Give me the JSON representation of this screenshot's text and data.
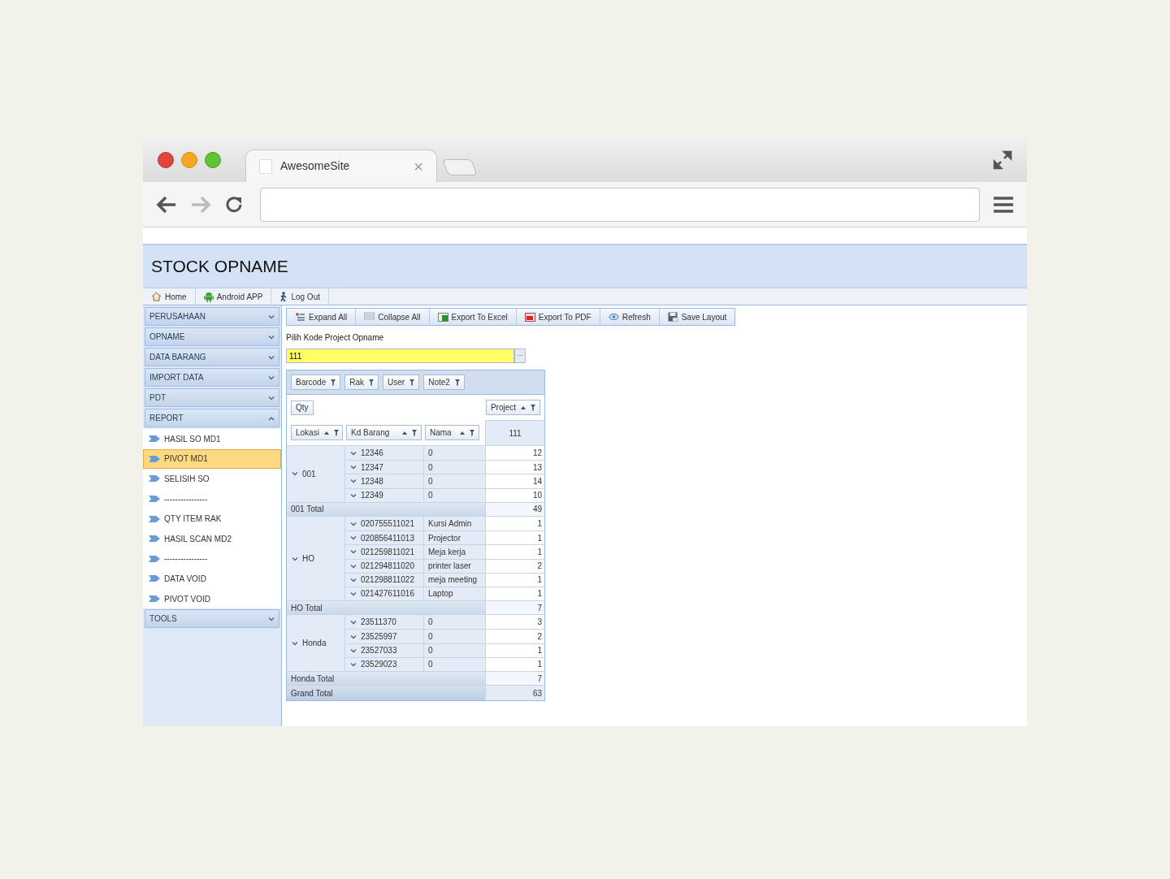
{
  "browser": {
    "tab_title": "AwesomeSite",
    "tab_close": "×"
  },
  "page": {
    "title": "STOCK OPNAME"
  },
  "nav": [
    {
      "label": "Home",
      "kind": "home"
    },
    {
      "label": "Android APP",
      "kind": "android"
    },
    {
      "label": "Log Out",
      "kind": "person"
    }
  ],
  "sidebar": [
    {
      "label": "PERUSAHAAN",
      "expanded": false
    },
    {
      "label": "OPNAME",
      "expanded": false
    },
    {
      "label": "DATA BARANG",
      "expanded": false
    },
    {
      "label": "IMPORT DATA",
      "expanded": false
    },
    {
      "label": "PDT",
      "expanded": false
    },
    {
      "label": "REPORT",
      "expanded": true,
      "items": [
        {
          "label": "HASIL SO MD1",
          "selected": false
        },
        {
          "label": "PIVOT MD1",
          "selected": true
        },
        {
          "label": "SELISIH SO",
          "selected": false
        },
        {
          "label": "----------------",
          "selected": false
        },
        {
          "label": "QTY ITEM RAK",
          "selected": false
        },
        {
          "label": "HASIL SCAN MD2",
          "selected": false
        },
        {
          "label": "----------------",
          "selected": false
        },
        {
          "label": "DATA VOID",
          "selected": false
        },
        {
          "label": "PIVOT VOID",
          "selected": false
        }
      ]
    },
    {
      "label": "TOOLS",
      "expanded": false
    }
  ],
  "toolbar": [
    {
      "label": "Expand All",
      "kind": "expand"
    },
    {
      "label": "Collapse All",
      "kind": "collapse"
    },
    {
      "label": "Export To Excel",
      "kind": "excel"
    },
    {
      "label": "Export To PDF",
      "kind": "pdf"
    },
    {
      "label": "Refresh",
      "kind": "refresh"
    },
    {
      "label": "Save Layout",
      "kind": "save"
    }
  ],
  "project_field": {
    "label": "Pilih Kode Project Opname",
    "value": "111",
    "button": "···"
  },
  "pivot": {
    "filter_fields": [
      {
        "label": "Barcode",
        "sorted": false
      },
      {
        "label": "Rak",
        "sorted": false
      },
      {
        "label": "User",
        "sorted": false
      },
      {
        "label": "Note2",
        "sorted": false
      }
    ],
    "data_field": "Qty",
    "column_field": {
      "label": "Project",
      "sorted": true
    },
    "row_fields": [
      {
        "label": "Lokasi",
        "sorted": true
      },
      {
        "label": "Kd Barang",
        "sorted": true
      },
      {
        "label": "Nama",
        "sorted": true
      }
    ],
    "column_value": "111",
    "groups": [
      {
        "label": "001",
        "expanded": true,
        "total_label": "001 Total",
        "total": "49",
        "rows": [
          {
            "code": "12346",
            "name": "0",
            "value": "12",
            "expanded": true
          },
          {
            "code": "12347",
            "name": "0",
            "value": "13",
            "expanded": true
          },
          {
            "code": "12348",
            "name": "0",
            "value": "14",
            "expanded": true
          },
          {
            "code": "12349",
            "name": "0",
            "value": "10",
            "expanded": true
          }
        ]
      },
      {
        "label": "HO",
        "expanded": true,
        "total_label": "HO Total",
        "total": "7",
        "rows": [
          {
            "code": "020755511021",
            "name": "Kursi Admin",
            "value": "1",
            "expanded": true
          },
          {
            "code": "020856411013",
            "name": "Projector",
            "value": "1",
            "expanded": true
          },
          {
            "code": "021259811021",
            "name": "Meja kerja",
            "value": "1",
            "expanded": true
          },
          {
            "code": "021294811020",
            "name": "printer laser",
            "value": "2",
            "expanded": true
          },
          {
            "code": "021298811022",
            "name": "meja meeting",
            "value": "1",
            "expanded": true
          },
          {
            "code": "021427611016",
            "name": "Laptop",
            "value": "1",
            "expanded": true
          }
        ]
      },
      {
        "label": "Honda",
        "expanded": true,
        "total_label": "Honda Total",
        "total": "7",
        "rows": [
          {
            "code": "23511370",
            "name": "0",
            "value": "3",
            "expanded": true
          },
          {
            "code": "23525997",
            "name": "0",
            "value": "2",
            "expanded": true
          },
          {
            "code": "23527033",
            "name": "0",
            "value": "1",
            "expanded": true
          },
          {
            "code": "23529023",
            "name": "0",
            "value": "1",
            "expanded": true
          }
        ]
      }
    ],
    "grand_total_label": "Grand Total",
    "grand_total": "63"
  }
}
